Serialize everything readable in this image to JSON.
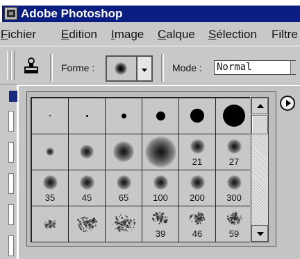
{
  "window": {
    "title": "Adobe Photoshop",
    "icon": "photoshop-app-icon"
  },
  "menu": {
    "items": [
      {
        "underline": "F",
        "rest": "ichier"
      },
      {
        "underline": "E",
        "rest": "dition"
      },
      {
        "underline": "I",
        "rest": "mage"
      },
      {
        "underline": "C",
        "rest": "alque"
      },
      {
        "underline": "S",
        "rest": "élection"
      },
      {
        "underline": "",
        "rest": "Filtre"
      }
    ]
  },
  "options": {
    "tool_icon": "rubber-stamp-icon",
    "forme_label": "Forme :",
    "mode_label": "Mode :",
    "mode_value": "Normal"
  },
  "brushes": {
    "rows": [
      [
        {
          "kind": "hard",
          "size": 2,
          "label": ""
        },
        {
          "kind": "hard",
          "size": 3,
          "label": ""
        },
        {
          "kind": "hard",
          "size": 7,
          "label": ""
        },
        {
          "kind": "hard",
          "size": 13,
          "label": ""
        },
        {
          "kind": "hard",
          "size": 20,
          "label": ""
        },
        {
          "kind": "hard",
          "size": 32,
          "label": ""
        }
      ],
      [
        {
          "kind": "soft",
          "size": 8,
          "label": ""
        },
        {
          "kind": "soft",
          "size": 13,
          "label": ""
        },
        {
          "kind": "soft",
          "size": 20,
          "label": ""
        },
        {
          "kind": "soft",
          "size": 30,
          "label": ""
        },
        {
          "kind": "soft",
          "size": 14,
          "label": "21"
        },
        {
          "kind": "soft",
          "size": 14,
          "label": "27"
        }
      ],
      [
        {
          "kind": "soft",
          "size": 14,
          "label": "35"
        },
        {
          "kind": "soft",
          "size": 14,
          "label": "45"
        },
        {
          "kind": "soft",
          "size": 14,
          "label": "65"
        },
        {
          "kind": "soft",
          "size": 14,
          "label": "100"
        },
        {
          "kind": "soft",
          "size": 14,
          "label": "200"
        },
        {
          "kind": "soft",
          "size": 14,
          "label": "300"
        }
      ],
      [
        {
          "kind": "splat",
          "size": 18,
          "label": ""
        },
        {
          "kind": "splat",
          "size": 30,
          "label": ""
        },
        {
          "kind": "splat",
          "size": 34,
          "label": ""
        },
        {
          "kind": "splat",
          "size": 22,
          "label": "39"
        },
        {
          "kind": "splat",
          "size": 22,
          "label": "46"
        },
        {
          "kind": "splat",
          "size": 22,
          "label": "59"
        }
      ]
    ]
  },
  "icons": {
    "palette_menu": "arrow-right-circle-icon",
    "scroll_up": "arrow-up-icon",
    "scroll_down": "arrow-down-icon",
    "forme_dropdown": "chevron-down-icon"
  }
}
